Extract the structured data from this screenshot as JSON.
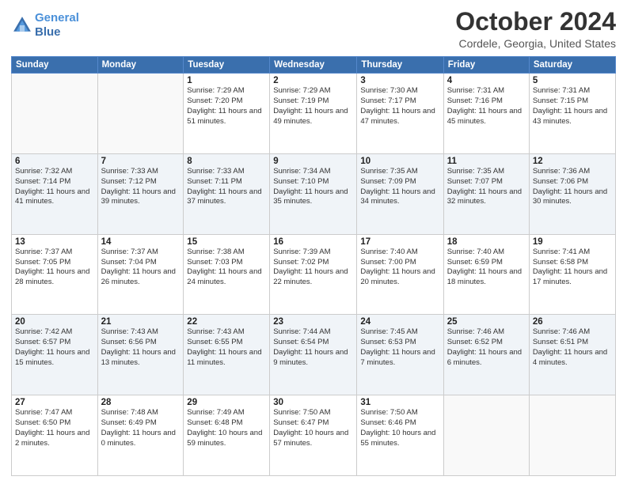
{
  "header": {
    "logo_line1": "General",
    "logo_line2": "Blue",
    "month": "October 2024",
    "location": "Cordele, Georgia, United States"
  },
  "weekdays": [
    "Sunday",
    "Monday",
    "Tuesday",
    "Wednesday",
    "Thursday",
    "Friday",
    "Saturday"
  ],
  "weeks": [
    [
      {
        "day": "",
        "info": ""
      },
      {
        "day": "",
        "info": ""
      },
      {
        "day": "1",
        "info": "Sunrise: 7:29 AM\nSunset: 7:20 PM\nDaylight: 11 hours and 51 minutes."
      },
      {
        "day": "2",
        "info": "Sunrise: 7:29 AM\nSunset: 7:19 PM\nDaylight: 11 hours and 49 minutes."
      },
      {
        "day": "3",
        "info": "Sunrise: 7:30 AM\nSunset: 7:17 PM\nDaylight: 11 hours and 47 minutes."
      },
      {
        "day": "4",
        "info": "Sunrise: 7:31 AM\nSunset: 7:16 PM\nDaylight: 11 hours and 45 minutes."
      },
      {
        "day": "5",
        "info": "Sunrise: 7:31 AM\nSunset: 7:15 PM\nDaylight: 11 hours and 43 minutes."
      }
    ],
    [
      {
        "day": "6",
        "info": "Sunrise: 7:32 AM\nSunset: 7:14 PM\nDaylight: 11 hours and 41 minutes."
      },
      {
        "day": "7",
        "info": "Sunrise: 7:33 AM\nSunset: 7:12 PM\nDaylight: 11 hours and 39 minutes."
      },
      {
        "day": "8",
        "info": "Sunrise: 7:33 AM\nSunset: 7:11 PM\nDaylight: 11 hours and 37 minutes."
      },
      {
        "day": "9",
        "info": "Sunrise: 7:34 AM\nSunset: 7:10 PM\nDaylight: 11 hours and 35 minutes."
      },
      {
        "day": "10",
        "info": "Sunrise: 7:35 AM\nSunset: 7:09 PM\nDaylight: 11 hours and 34 minutes."
      },
      {
        "day": "11",
        "info": "Sunrise: 7:35 AM\nSunset: 7:07 PM\nDaylight: 11 hours and 32 minutes."
      },
      {
        "day": "12",
        "info": "Sunrise: 7:36 AM\nSunset: 7:06 PM\nDaylight: 11 hours and 30 minutes."
      }
    ],
    [
      {
        "day": "13",
        "info": "Sunrise: 7:37 AM\nSunset: 7:05 PM\nDaylight: 11 hours and 28 minutes."
      },
      {
        "day": "14",
        "info": "Sunrise: 7:37 AM\nSunset: 7:04 PM\nDaylight: 11 hours and 26 minutes."
      },
      {
        "day": "15",
        "info": "Sunrise: 7:38 AM\nSunset: 7:03 PM\nDaylight: 11 hours and 24 minutes."
      },
      {
        "day": "16",
        "info": "Sunrise: 7:39 AM\nSunset: 7:02 PM\nDaylight: 11 hours and 22 minutes."
      },
      {
        "day": "17",
        "info": "Sunrise: 7:40 AM\nSunset: 7:00 PM\nDaylight: 11 hours and 20 minutes."
      },
      {
        "day": "18",
        "info": "Sunrise: 7:40 AM\nSunset: 6:59 PM\nDaylight: 11 hours and 18 minutes."
      },
      {
        "day": "19",
        "info": "Sunrise: 7:41 AM\nSunset: 6:58 PM\nDaylight: 11 hours and 17 minutes."
      }
    ],
    [
      {
        "day": "20",
        "info": "Sunrise: 7:42 AM\nSunset: 6:57 PM\nDaylight: 11 hours and 15 minutes."
      },
      {
        "day": "21",
        "info": "Sunrise: 7:43 AM\nSunset: 6:56 PM\nDaylight: 11 hours and 13 minutes."
      },
      {
        "day": "22",
        "info": "Sunrise: 7:43 AM\nSunset: 6:55 PM\nDaylight: 11 hours and 11 minutes."
      },
      {
        "day": "23",
        "info": "Sunrise: 7:44 AM\nSunset: 6:54 PM\nDaylight: 11 hours and 9 minutes."
      },
      {
        "day": "24",
        "info": "Sunrise: 7:45 AM\nSunset: 6:53 PM\nDaylight: 11 hours and 7 minutes."
      },
      {
        "day": "25",
        "info": "Sunrise: 7:46 AM\nSunset: 6:52 PM\nDaylight: 11 hours and 6 minutes."
      },
      {
        "day": "26",
        "info": "Sunrise: 7:46 AM\nSunset: 6:51 PM\nDaylight: 11 hours and 4 minutes."
      }
    ],
    [
      {
        "day": "27",
        "info": "Sunrise: 7:47 AM\nSunset: 6:50 PM\nDaylight: 11 hours and 2 minutes."
      },
      {
        "day": "28",
        "info": "Sunrise: 7:48 AM\nSunset: 6:49 PM\nDaylight: 11 hours and 0 minutes."
      },
      {
        "day": "29",
        "info": "Sunrise: 7:49 AM\nSunset: 6:48 PM\nDaylight: 10 hours and 59 minutes."
      },
      {
        "day": "30",
        "info": "Sunrise: 7:50 AM\nSunset: 6:47 PM\nDaylight: 10 hours and 57 minutes."
      },
      {
        "day": "31",
        "info": "Sunrise: 7:50 AM\nSunset: 6:46 PM\nDaylight: 10 hours and 55 minutes."
      },
      {
        "day": "",
        "info": ""
      },
      {
        "day": "",
        "info": ""
      }
    ]
  ]
}
